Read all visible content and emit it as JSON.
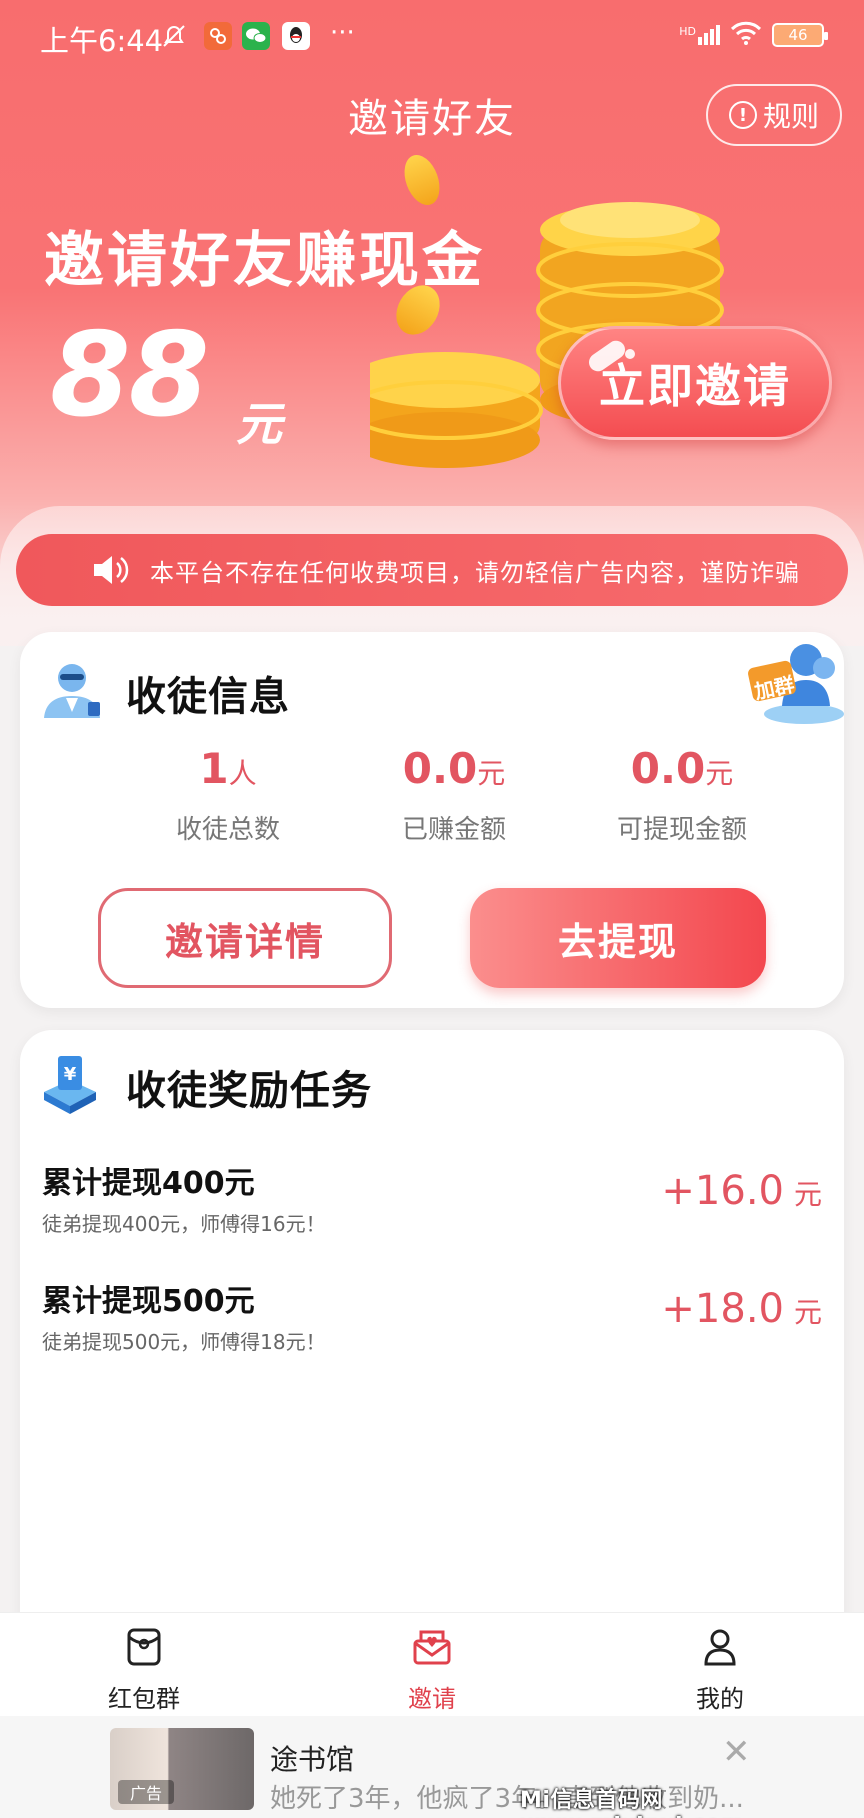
{
  "status_bar": {
    "time": "上午6:44",
    "more": "···",
    "battery": "46",
    "network": "HD"
  },
  "header": {
    "title": "邀请好友",
    "rules_label": "规则"
  },
  "hero": {
    "heading": "邀请好友赚现金",
    "amount": "88",
    "unit": "元",
    "invite_button": "立即邀请"
  },
  "notice": {
    "text": "本平台不存在任何收费项目，请勿轻信广告内容，谨防诈骗"
  },
  "apprentice_info": {
    "title": "收徒信息",
    "join_badge": "加群",
    "stats": [
      {
        "value": "1",
        "unit": "人",
        "label": "收徒总数"
      },
      {
        "value": "0.0",
        "unit": "元",
        "label": "已赚金额"
      },
      {
        "value": "0.0",
        "unit": "元",
        "label": "可提现金额"
      }
    ],
    "details_button": "邀请详情",
    "withdraw_button": "去提现"
  },
  "reward_tasks": {
    "title": "收徒奖励任务",
    "items": [
      {
        "title": "累计提现400元",
        "subtitle": "徒弟提现400元，师傅得16元！",
        "reward": "+16.0",
        "unit": "元"
      },
      {
        "title": "累计提现500元",
        "subtitle": "徒弟提现500元，师傅得18元！",
        "reward": "+18.0",
        "unit": "元"
      }
    ]
  },
  "tabbar": {
    "tabs": [
      {
        "label": "红包群",
        "icon": "red-packet-icon"
      },
      {
        "label": "邀请",
        "icon": "invite-envelope-icon"
      },
      {
        "label": "我的",
        "icon": "user-icon"
      }
    ],
    "active": "邀请"
  },
  "ad": {
    "title": "途书馆",
    "description": "她死了3年，他疯了3年。直到他收到奶...",
    "tag": "广告"
  },
  "watermark": "Mi信息首码网 www.mixinxi.com",
  "colors": {
    "accent": "#f3474e",
    "accent_text": "#e25561",
    "hero_bg": "#f86d6e"
  }
}
